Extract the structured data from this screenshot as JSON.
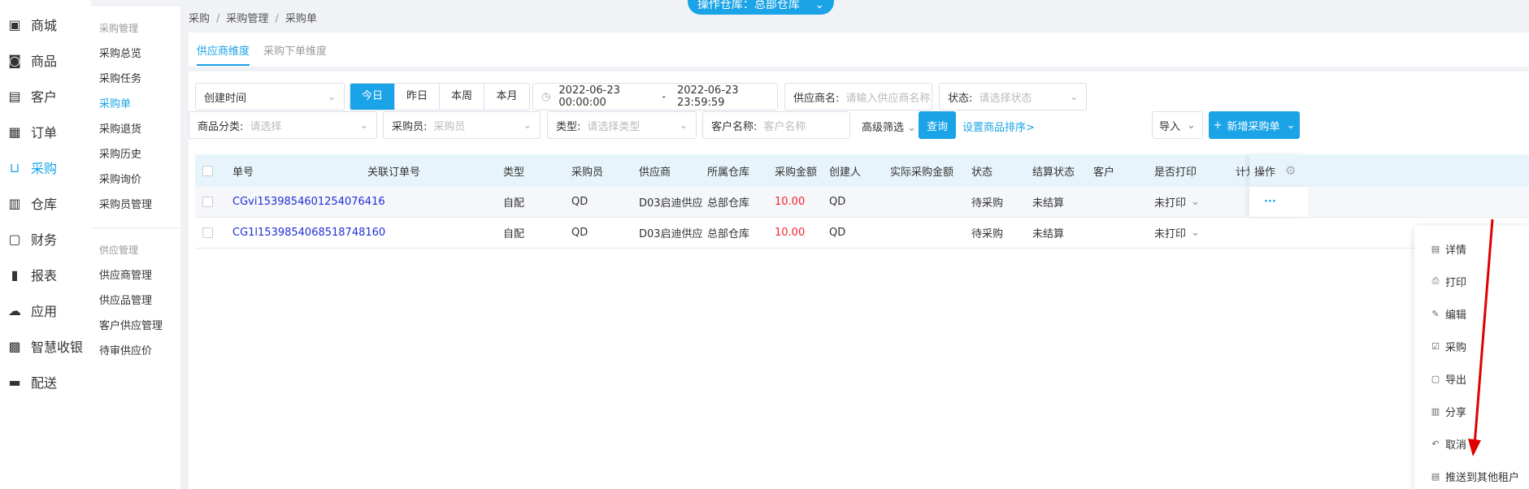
{
  "top_badge": "操作仓库：总部仓库",
  "sidebar": {
    "items": [
      {
        "label": "商城",
        "icon": "store-icon"
      },
      {
        "label": "商品",
        "icon": "bag-icon"
      },
      {
        "label": "客户",
        "icon": "contact-card-icon"
      },
      {
        "label": "订单",
        "icon": "clipboard-icon"
      },
      {
        "label": "采购",
        "icon": "basket-icon"
      },
      {
        "label": "仓库",
        "icon": "warehouse-icon"
      },
      {
        "label": "财务",
        "icon": "wallet-icon"
      },
      {
        "label": "报表",
        "icon": "bar-chart-icon"
      },
      {
        "label": "应用",
        "icon": "cloud-icon"
      },
      {
        "label": "智慧收银",
        "icon": "cash-register-icon"
      },
      {
        "label": "配送",
        "icon": "truck-icon"
      }
    ],
    "active_index": 4
  },
  "subnav": {
    "group1_title": "采购管理",
    "group1_items": [
      "采购总览",
      "采购任务",
      "采购单",
      "采购退货",
      "采购历史",
      "采购询价",
      "采购员管理"
    ],
    "group2_title": "供应管理",
    "group2_items": [
      "供应商管理",
      "供应品管理",
      "客户供应管理",
      "待审供应价"
    ]
  },
  "breadcrumb": [
    "采购",
    "采购管理",
    "采购单"
  ],
  "tabs": [
    "供应商维度",
    "采购下单维度"
  ],
  "filters": {
    "date_type": "创建时间",
    "quick_dates": [
      "今日",
      "昨日",
      "本周",
      "本月"
    ],
    "date_start": "2022-06-23 00:00:00",
    "date_sep": "-",
    "date_end": "2022-06-23 23:59:59",
    "supplier_label": "供应商名:",
    "supplier_placeholder": "请输入供应商名称",
    "status_label": "状态:",
    "status_placeholder": "请选择状态",
    "category_label": "商品分类:",
    "category_placeholder": "请选择",
    "buyer_label": "采购员:",
    "buyer_placeholder": "采购员",
    "type_label": "类型:",
    "type_placeholder": "请选择类型",
    "customer_label": "客户名称:",
    "customer_placeholder": "客户名称",
    "advanced": "高级筛选",
    "query": "查询",
    "sort_link": "设置商品排序>",
    "import": "导入",
    "new_order": "新增采购单"
  },
  "table": {
    "headers": [
      "单号",
      "关联订单号",
      "类型",
      "采购员",
      "供应商",
      "所属仓库",
      "采购金额",
      "创建人",
      "实际采购金额",
      "状态",
      "结算状态",
      "客户",
      "是否打印",
      "计划",
      "操作"
    ],
    "rows": [
      {
        "no": "CGvi1539854601254076416",
        "type": "自配",
        "buyer": "QD",
        "supplier": "D03启迪供应",
        "warehouse": "总部仓库",
        "amount": "10.00",
        "creator": "QD",
        "status": "待采购",
        "settle": "未结算",
        "print": "未打印",
        "more": "···"
      },
      {
        "no": "CG1l1539854068518748160",
        "type": "自配",
        "buyer": "QD",
        "supplier": "D03启迪供应",
        "warehouse": "总部仓库",
        "amount": "10.00",
        "creator": "QD",
        "status": "待采购",
        "settle": "未结算",
        "print": "未打印"
      }
    ]
  },
  "menu": {
    "items": [
      {
        "label": "详情",
        "icon": "doc-icon"
      },
      {
        "label": "打印",
        "icon": "printer-icon"
      },
      {
        "label": "编辑",
        "icon": "edit-icon"
      },
      {
        "label": "采购",
        "icon": "cart-check-icon"
      },
      {
        "label": "导出",
        "icon": "export-icon"
      },
      {
        "label": "分享",
        "icon": "share-icon"
      },
      {
        "label": "取消",
        "icon": "undo-icon"
      },
      {
        "label": "推送到其他租户",
        "icon": "push-icon"
      }
    ]
  },
  "colors": {
    "accent": "#1aa3e6",
    "amount": "#f5222d",
    "annotation_arrow": "#e00000"
  }
}
